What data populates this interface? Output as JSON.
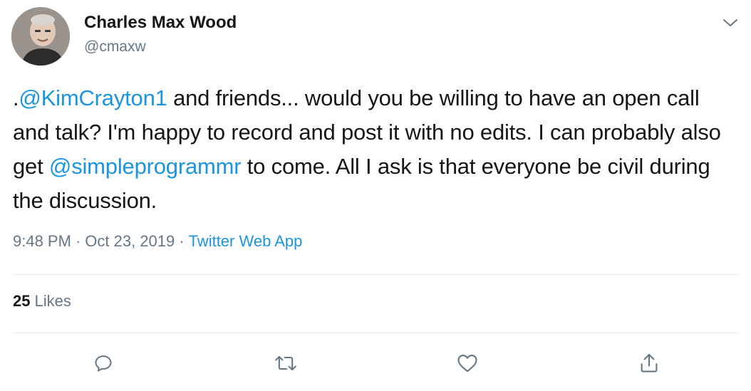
{
  "author": {
    "name": "Charles Max Wood",
    "handle": "@cmaxw"
  },
  "tweet": {
    "prefix": ".",
    "mention1": "@KimCrayton1",
    "part1": " and friends... would you be willing to have an open call and talk? I'm happy to record and post it with no edits. I can probably also get ",
    "mention2": "@simpleprogrammr",
    "part2": " to come. All I ask is that everyone be civil during the discussion."
  },
  "meta": {
    "time": "9:48 PM",
    "separator": "·",
    "date": "Oct 23, 2019",
    "source": "Twitter Web App"
  },
  "stats": {
    "likes_count": "25",
    "likes_label": "Likes"
  },
  "icons": {
    "caret": "chevron-down-icon",
    "reply": "reply-icon",
    "retweet": "retweet-icon",
    "like": "heart-icon",
    "share": "share-icon"
  },
  "colors": {
    "link": "#1b95e0",
    "secondary": "#657786",
    "text": "#14171a",
    "divider": "#e6ecf0"
  }
}
